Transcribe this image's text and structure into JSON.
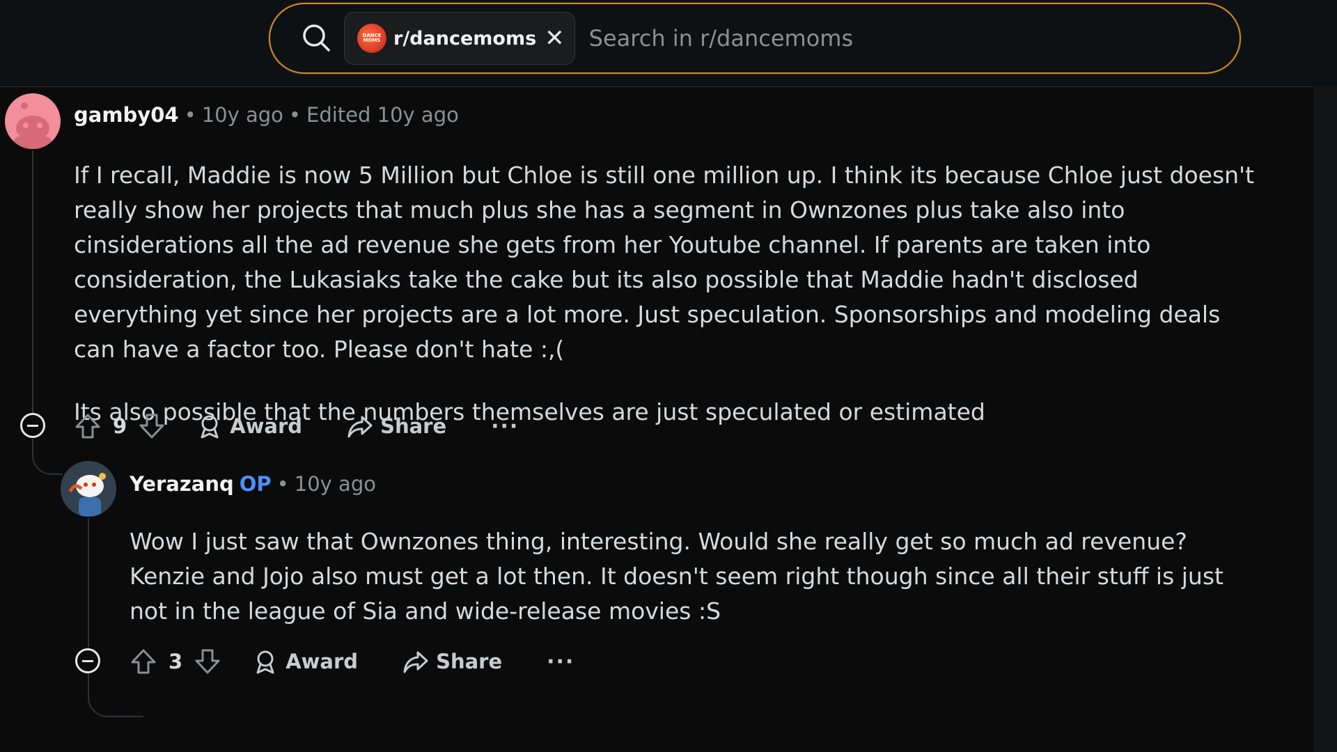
{
  "search": {
    "community_chip": "r/dancemoms",
    "community_avatar_text": "DANCE MOMS",
    "placeholder": "Search in r/dancemoms",
    "chip_close": "✕"
  },
  "comments": [
    {
      "username": "gamby04",
      "time": "10y ago",
      "edited": "Edited 10y ago",
      "paragraphs": [
        "If I recall, Maddie is now 5 Million but Chloe is still one million up. I think its because Chloe just doesn't really show her projects that much plus she has a segment in Ownzones plus take also into cinsiderations all the ad revenue she gets from her Youtube channel. If parents are taken into consideration, the Lukasiaks take the cake but its also possible that Maddie hadn't disclosed everything yet since her projects are a lot more. Just speculation. Sponsorships and modeling deals can have a factor too. Please don't hate :,(",
        "Its also possible that the numbers themselves are just speculated or estimated"
      ],
      "score": "9",
      "award_label": "Award",
      "share_label": "Share",
      "more_label": "···"
    },
    {
      "username": "Yerazanq",
      "op_badge": "OP",
      "time": "10y ago",
      "paragraphs": [
        "Wow I just saw that Ownzones thing, interesting. Would she really get so much ad revenue? Kenzie and Jojo also must get a lot then. It doesn't seem right though since all their stuff is just not in the league of Sia and wide-release movies :S"
      ],
      "score": "3",
      "award_label": "Award",
      "share_label": "Share",
      "more_label": "···"
    }
  ],
  "meta_separator": "•",
  "colors": {
    "accent_border": "#d08a2c",
    "op_blue": "#4d8fff",
    "background": "#0b0b0b"
  }
}
